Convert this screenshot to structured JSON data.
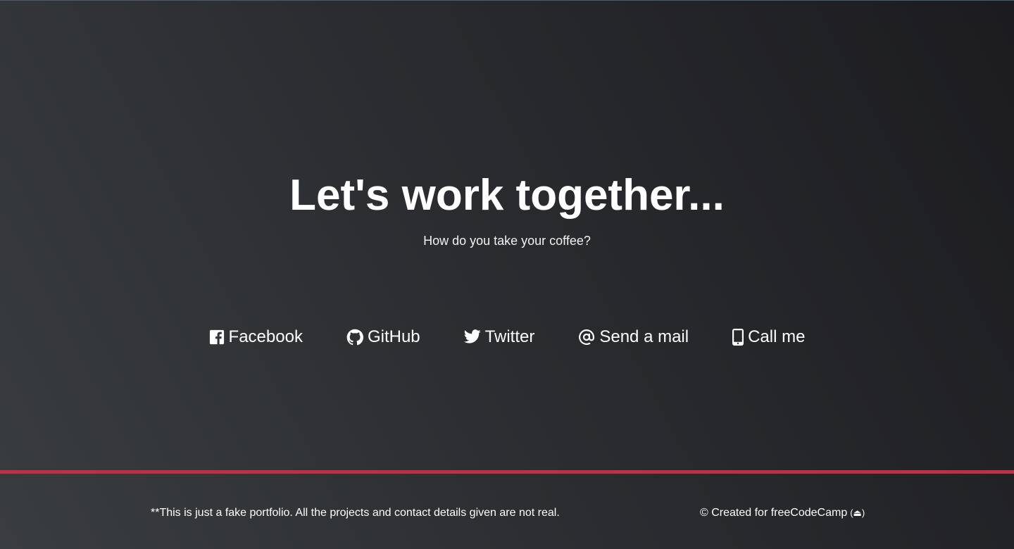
{
  "contact": {
    "headline": "Let's work together...",
    "subtitle": "How do you take your coffee?",
    "links": [
      {
        "label": "Facebook",
        "icon": "facebook-icon"
      },
      {
        "label": "GitHub",
        "icon": "github-icon"
      },
      {
        "label": "Twitter",
        "icon": "twitter-icon"
      },
      {
        "label": "Send a mail",
        "icon": "at-icon"
      },
      {
        "label": "Call me",
        "icon": "mobile-phone-icon"
      }
    ]
  },
  "footer": {
    "note": "**This is just a fake portfolio. All the projects and contact details given are not real.",
    "credit": "© Created for freeCodeCamp",
    "credit_icon": "(⏏)"
  },
  "colors": {
    "accent_rule": "#be3144",
    "text": "#ffffff",
    "background_light": "#3a3d40",
    "background_dark": "#1c1c1f"
  }
}
